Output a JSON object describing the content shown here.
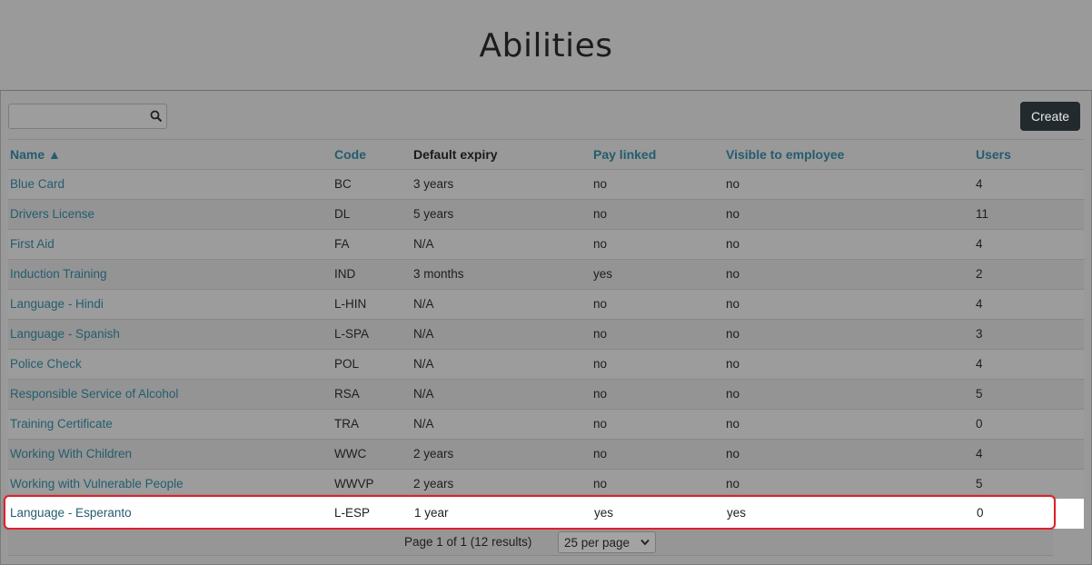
{
  "header": {
    "title": "Abilities"
  },
  "search": {
    "placeholder": "",
    "value": ""
  },
  "toolbar": {
    "create_label": "Create"
  },
  "table": {
    "columns": [
      "Name ▲",
      "Code",
      "Default expiry",
      "Pay linked",
      "Visible to employee",
      "Users"
    ],
    "rows": [
      [
        "Blue Card",
        "BC",
        "3 years",
        "no",
        "no",
        "4"
      ],
      [
        "Drivers License",
        "DL",
        "5 years",
        "no",
        "no",
        "11"
      ],
      [
        "First Aid",
        "FA",
        "N/A",
        "no",
        "no",
        "4"
      ],
      [
        "Induction Training",
        "IND",
        "3 months",
        "yes",
        "no",
        "2"
      ],
      [
        "Language - Hindi",
        "L-HIN",
        "N/A",
        "no",
        "no",
        "4"
      ],
      [
        "Language - Spanish",
        "L-SPA",
        "N/A",
        "no",
        "no",
        "3"
      ],
      [
        "Police Check",
        "POL",
        "N/A",
        "no",
        "no",
        "4"
      ],
      [
        "Responsible Service of Alcohol",
        "RSA",
        "N/A",
        "no",
        "no",
        "5"
      ],
      [
        "Training Certificate",
        "TRA",
        "N/A",
        "no",
        "no",
        "0"
      ],
      [
        "Working With Children",
        "WWC",
        "2 years",
        "no",
        "no",
        "4"
      ],
      [
        "Working with Vulnerable People",
        "WWVP",
        "2 years",
        "no",
        "no",
        "5"
      ]
    ],
    "highlighted_row": [
      "Language - Esperanto",
      "L-ESP",
      "1 year",
      "yes",
      "yes",
      "0"
    ]
  },
  "pager": {
    "summary": "Page 1 of 1 (12 results)",
    "per_page": "25 per page"
  },
  "colors": {
    "link": "#245d6e",
    "highlight_border": "#e0202a",
    "button_bg": "#222a2e"
  }
}
